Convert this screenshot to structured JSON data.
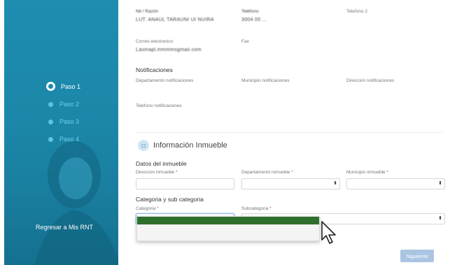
{
  "sidebar": {
    "steps": [
      {
        "label": "Paso 1",
        "active": true
      },
      {
        "label": "Paso 2",
        "active": false
      },
      {
        "label": "Paso 3",
        "active": false
      },
      {
        "label": "Paso 4",
        "active": false
      }
    ],
    "back_link": "Regresar a Mis RNT"
  },
  "contact": {
    "col1_label": "Nit / Razón",
    "col1_value": "LUT. ANAUL TARAUNI UI NUIRA",
    "col2_label": "Teléfono",
    "col2_value": "3004 00 ...",
    "col3_label": "Telefono 2",
    "email_label": "Correo electronico",
    "email_value": "Lasmapl.mmmmsgmail.com",
    "fax_label": "Fax"
  },
  "notificaciones": {
    "heading": "Notificaciones",
    "departamento_label": "Departamento notificaciones",
    "municipio_label": "Municipio notificaciones",
    "direccion_label": "Direccion notificaciones",
    "telefono_label": "Telefono notificaciones"
  },
  "inmueble": {
    "title": "Información Inmueble",
    "datos_heading": "Datos del inmueble",
    "direccion_label": "Direccion inmueble",
    "departamento_label": "Departamento inmueble",
    "municipio_label": "Municipio inmueble",
    "required_mark": "*",
    "categoria_heading": "Categoria y sub categoria",
    "categoria_label": "Categoria",
    "subcategoria_label": "Subcategoria"
  },
  "buttons": {
    "next": "Siguiente"
  },
  "colors": {
    "sidebar": "#1e8db0",
    "dropdown_selected": "#2e6f2e",
    "next_button": "#a9c5e2"
  }
}
